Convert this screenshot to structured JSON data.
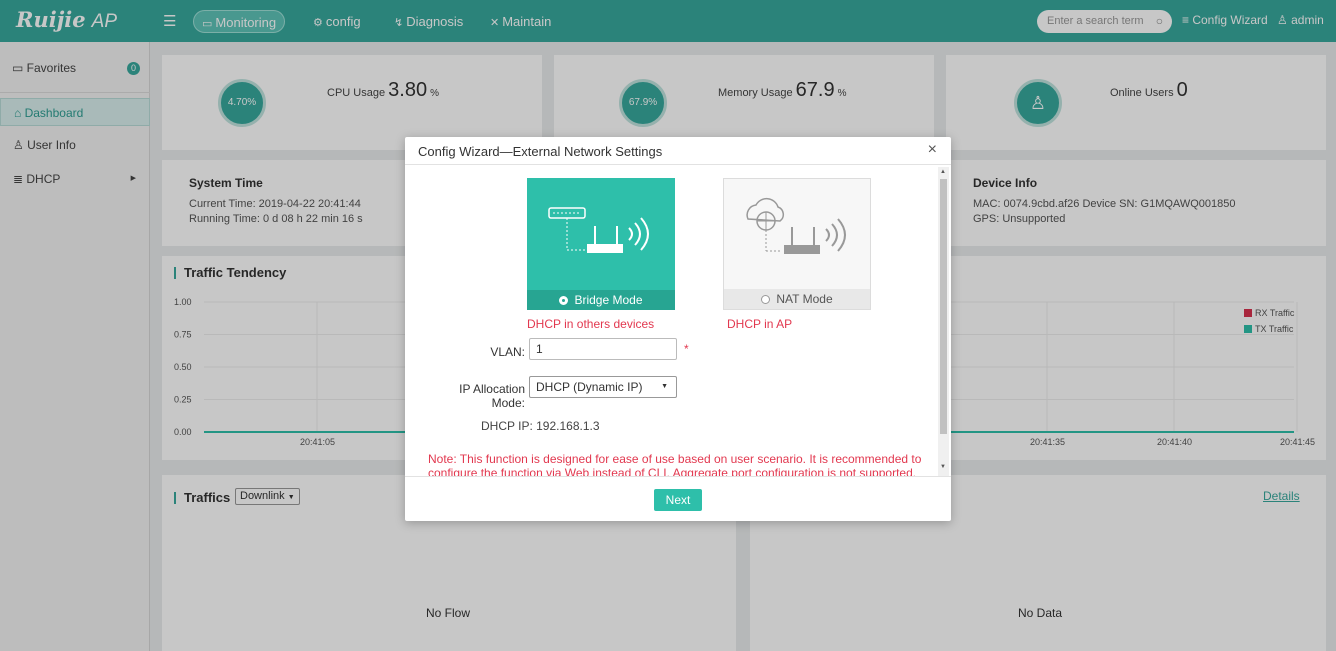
{
  "app": {
    "logo": "Ruijie",
    "logo_suffix": "AP"
  },
  "nav": {
    "items": [
      {
        "label": "Monitoring",
        "icon": "monitor-icon"
      },
      {
        "label": "config",
        "icon": "gear-icon"
      },
      {
        "label": "Diagnosis",
        "icon": "diagnosis-icon"
      },
      {
        "label": "Maintain",
        "icon": "tools-icon"
      }
    ],
    "search_placeholder": "Enter a search term",
    "config_wizard": "Config Wizard",
    "user": "admin"
  },
  "sidebar": {
    "favorites_label": "Favorites",
    "favorites_count": "0",
    "items": [
      {
        "label": "Dashboard",
        "icon": "home-icon"
      },
      {
        "label": "User Info",
        "icon": "user-icon"
      },
      {
        "label": "DHCP",
        "icon": "dhcp-icon"
      }
    ]
  },
  "stats": {
    "cpu": {
      "gauge": "4.70%",
      "label": "CPU Usage",
      "value": "3.80",
      "unit": "%"
    },
    "memory": {
      "gauge": "67.9%",
      "label": "Memory Usage",
      "value": "67.9",
      "unit": "%"
    },
    "users": {
      "label": "Online Users",
      "value": "0"
    }
  },
  "system_time": {
    "title": "System Time",
    "current": "Current Time: 2019-04-22 20:41:44",
    "running": "Running Time: 0 d 08 h 22 min 16 s"
  },
  "device_info": {
    "title": "Device Info",
    "mac_sn": "MAC: 0074.9cbd.af26 Device SN: G1MQAWQ001850",
    "gps": "GPS: Unsupported"
  },
  "traffic_tendency": {
    "title": "Traffic Tendency",
    "legend_rx": "RX Traffic",
    "legend_tx": "TX Traffic",
    "rx_color": "#d8314f",
    "tx_color": "#2ebfaa"
  },
  "chart_data": {
    "type": "line",
    "yticks": [
      "1.00",
      "0.75",
      "0.50",
      "0.25",
      "0.00"
    ],
    "xticks_visible": [
      "20:41:05",
      "20:41:35",
      "20:41:40",
      "20:41:45"
    ],
    "series": [
      {
        "name": "RX Traffic",
        "values": [
          0,
          0,
          0,
          0
        ]
      },
      {
        "name": "TX Traffic",
        "values": [
          0,
          0,
          0,
          0
        ]
      }
    ],
    "ylim": [
      0,
      1
    ]
  },
  "traffics": {
    "title": "Traffics",
    "dropdown": "Downlink",
    "empty_left": "No Flow",
    "empty_right": "No Data",
    "details": "Details"
  },
  "modal": {
    "title": "Config Wizard—External Network Settings",
    "bridge_label": "Bridge Mode",
    "bridge_sub": "DHCP in others devices",
    "nat_label": "NAT Mode",
    "nat_sub": "DHCP in AP",
    "vlan_label": "VLAN:",
    "vlan_value": "1",
    "ip_mode_label": "IP Allocation Mode:",
    "ip_mode_value": "DHCP (Dynamic IP)",
    "dhcp_ip": "DHCP IP: 192.168.1.3",
    "note": "Note:  This function is designed for ease of use based on user scenario. It is recommended to configure the function via Web instead of CLI. Aggregate port configuration is not supported.",
    "next": "Next"
  }
}
